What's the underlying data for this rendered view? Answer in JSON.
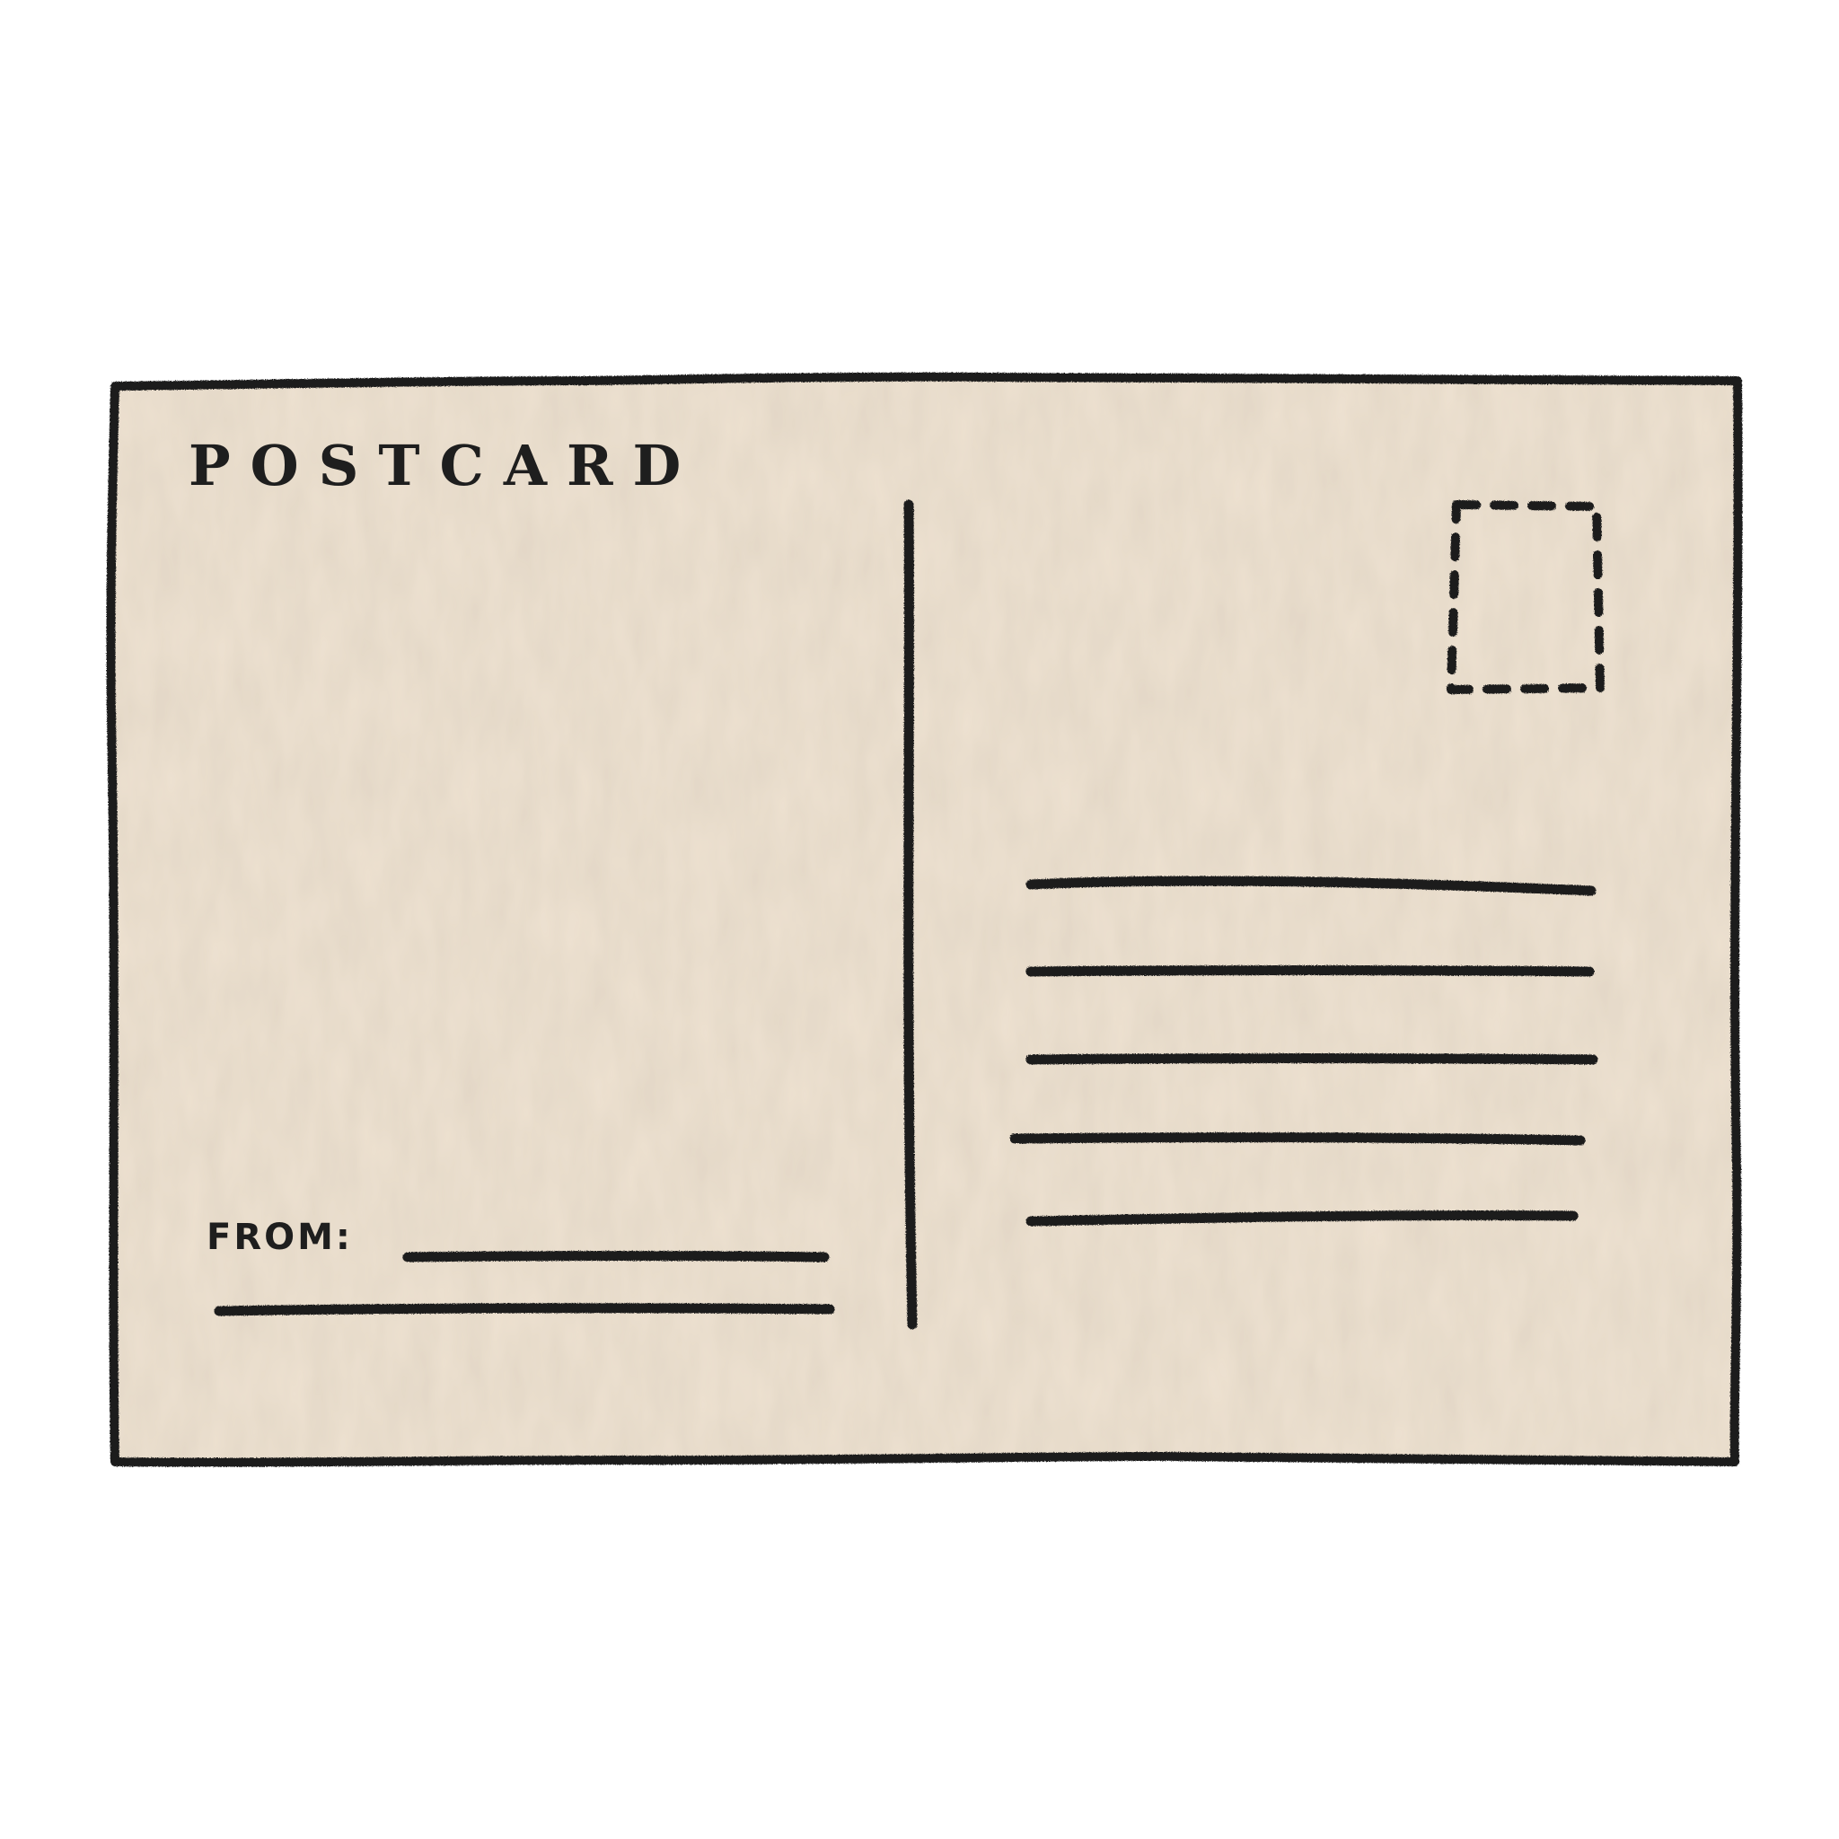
{
  "postcard": {
    "title": "POSTCARD",
    "from_label": "FROM:"
  },
  "colors": {
    "page_background": "#ffffff",
    "paper": "#eee2d1",
    "ink": "#1e1e1e"
  },
  "icons": {
    "stamp": "stamp-placeholder-icon"
  }
}
